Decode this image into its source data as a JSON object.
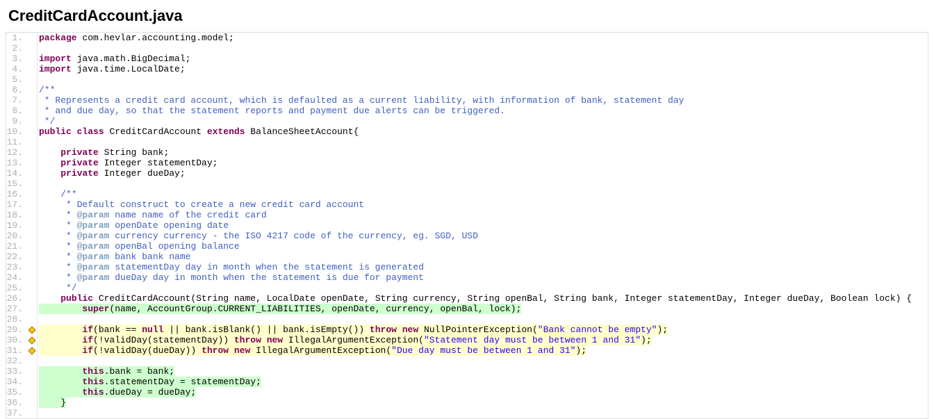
{
  "title": "CreditCardAccount.java",
  "lines": [
    {
      "n": 1,
      "glyph": false,
      "segs": [
        {
          "t": "package",
          "c": "kw"
        },
        {
          "t": " com.hevlar.accounting.model;"
        }
      ]
    },
    {
      "n": 2,
      "glyph": false,
      "segs": []
    },
    {
      "n": 3,
      "glyph": false,
      "segs": [
        {
          "t": "import",
          "c": "kw"
        },
        {
          "t": " java.math.BigDecimal;"
        }
      ]
    },
    {
      "n": 4,
      "glyph": false,
      "segs": [
        {
          "t": "import",
          "c": "kw"
        },
        {
          "t": " java.time.LocalDate;"
        }
      ]
    },
    {
      "n": 5,
      "glyph": false,
      "segs": []
    },
    {
      "n": 6,
      "glyph": false,
      "segs": [
        {
          "t": "/**",
          "c": "cmt"
        }
      ]
    },
    {
      "n": 7,
      "glyph": false,
      "segs": [
        {
          "t": " * Represents a credit card account, which is defaulted as a current liability, with information of bank, statement day",
          "c": "cmt"
        }
      ]
    },
    {
      "n": 8,
      "glyph": false,
      "segs": [
        {
          "t": " * and due day, so that the statement reports and payment due alerts can be triggered.",
          "c": "cmt"
        }
      ]
    },
    {
      "n": 9,
      "glyph": false,
      "segs": [
        {
          "t": " */",
          "c": "cmt"
        }
      ]
    },
    {
      "n": 10,
      "glyph": false,
      "segs": [
        {
          "t": "public",
          "c": "kw"
        },
        {
          "t": " "
        },
        {
          "t": "class",
          "c": "kw"
        },
        {
          "t": " CreditCardAccount "
        },
        {
          "t": "extends",
          "c": "kw"
        },
        {
          "t": " BalanceSheetAccount{"
        }
      ]
    },
    {
      "n": 11,
      "glyph": false,
      "segs": []
    },
    {
      "n": 12,
      "glyph": false,
      "segs": [
        {
          "t": "    "
        },
        {
          "t": "private",
          "c": "kw"
        },
        {
          "t": " String bank;"
        }
      ]
    },
    {
      "n": 13,
      "glyph": false,
      "segs": [
        {
          "t": "    "
        },
        {
          "t": "private",
          "c": "kw"
        },
        {
          "t": " Integer statementDay;"
        }
      ]
    },
    {
      "n": 14,
      "glyph": false,
      "segs": [
        {
          "t": "    "
        },
        {
          "t": "private",
          "c": "kw"
        },
        {
          "t": " Integer dueDay;"
        }
      ]
    },
    {
      "n": 15,
      "glyph": false,
      "segs": []
    },
    {
      "n": 16,
      "glyph": false,
      "segs": [
        {
          "t": "    "
        },
        {
          "t": "/**",
          "c": "cmt"
        }
      ]
    },
    {
      "n": 17,
      "glyph": false,
      "segs": [
        {
          "t": "     * Default construct to create a new credit card account",
          "c": "cmt"
        }
      ]
    },
    {
      "n": 18,
      "glyph": false,
      "segs": [
        {
          "t": "     * ",
          "c": "cmt"
        },
        {
          "t": "@param",
          "c": "ann"
        },
        {
          "t": " name name of the credit card",
          "c": "cmt"
        }
      ]
    },
    {
      "n": 19,
      "glyph": false,
      "segs": [
        {
          "t": "     * ",
          "c": "cmt"
        },
        {
          "t": "@param",
          "c": "ann"
        },
        {
          "t": " openDate opening date",
          "c": "cmt"
        }
      ]
    },
    {
      "n": 20,
      "glyph": false,
      "segs": [
        {
          "t": "     * ",
          "c": "cmt"
        },
        {
          "t": "@param",
          "c": "ann"
        },
        {
          "t": " currency currency - the ISO 4217 code of the currency, eg. SGD, USD",
          "c": "cmt"
        }
      ]
    },
    {
      "n": 21,
      "glyph": false,
      "segs": [
        {
          "t": "     * ",
          "c": "cmt"
        },
        {
          "t": "@param",
          "c": "ann"
        },
        {
          "t": " openBal opening balance",
          "c": "cmt"
        }
      ]
    },
    {
      "n": 22,
      "glyph": false,
      "segs": [
        {
          "t": "     * ",
          "c": "cmt"
        },
        {
          "t": "@param",
          "c": "ann"
        },
        {
          "t": " bank bank name",
          "c": "cmt"
        }
      ]
    },
    {
      "n": 23,
      "glyph": false,
      "segs": [
        {
          "t": "     * ",
          "c": "cmt"
        },
        {
          "t": "@param",
          "c": "ann"
        },
        {
          "t": " statementDay day in month when the statement is generated",
          "c": "cmt"
        }
      ]
    },
    {
      "n": 24,
      "glyph": false,
      "segs": [
        {
          "t": "     * ",
          "c": "cmt"
        },
        {
          "t": "@param",
          "c": "ann"
        },
        {
          "t": " dueDay day in month when the statement is due for payment",
          "c": "cmt"
        }
      ]
    },
    {
      "n": 25,
      "glyph": false,
      "segs": [
        {
          "t": "     */",
          "c": "cmt"
        }
      ]
    },
    {
      "n": 26,
      "glyph": false,
      "segs": [
        {
          "t": "    "
        },
        {
          "t": "public",
          "c": "kw"
        },
        {
          "t": " CreditCardAccount(String name, LocalDate openDate, String currency, String openBal, String bank, Integer statementDay, Integer dueDay, Boolean lock) {"
        }
      ]
    },
    {
      "n": 27,
      "glyph": false,
      "hl": "green",
      "segs": [
        {
          "t": "        "
        },
        {
          "t": "super",
          "c": "kw"
        },
        {
          "t": "(name, AccountGroup.CURRENT_LIABILITIES, openDate, currency, openBal, lock);"
        }
      ]
    },
    {
      "n": 28,
      "glyph": false,
      "segs": []
    },
    {
      "n": 29,
      "glyph": true,
      "hl": "yellow",
      "segs": [
        {
          "t": "        "
        },
        {
          "t": "if",
          "c": "kw"
        },
        {
          "t": "(bank == "
        },
        {
          "t": "null",
          "c": "kw"
        },
        {
          "t": " || bank.isBlank() || bank.isEmpty()) "
        },
        {
          "t": "throw",
          "c": "kw"
        },
        {
          "t": " "
        },
        {
          "t": "new",
          "c": "kw"
        },
        {
          "t": " NullPointerException("
        },
        {
          "t": "\"Bank cannot be empty\"",
          "c": "str"
        },
        {
          "t": ");"
        }
      ]
    },
    {
      "n": 30,
      "glyph": true,
      "hl": "yellow",
      "segs": [
        {
          "t": "        "
        },
        {
          "t": "if",
          "c": "kw"
        },
        {
          "t": "(!validDay(statementDay)) "
        },
        {
          "t": "throw",
          "c": "kw"
        },
        {
          "t": " "
        },
        {
          "t": "new",
          "c": "kw"
        },
        {
          "t": " IllegalArgumentException("
        },
        {
          "t": "\"Statement day must be between 1 and 31\"",
          "c": "str"
        },
        {
          "t": ");"
        }
      ]
    },
    {
      "n": 31,
      "glyph": true,
      "hl": "yellow",
      "segs": [
        {
          "t": "        "
        },
        {
          "t": "if",
          "c": "kw"
        },
        {
          "t": "(!validDay(dueDay)) "
        },
        {
          "t": "throw",
          "c": "kw"
        },
        {
          "t": " "
        },
        {
          "t": "new",
          "c": "kw"
        },
        {
          "t": " IllegalArgumentException("
        },
        {
          "t": "\"Due day must be between 1 and 31\"",
          "c": "str"
        },
        {
          "t": ");"
        }
      ]
    },
    {
      "n": 32,
      "glyph": false,
      "segs": []
    },
    {
      "n": 33,
      "glyph": false,
      "hl": "green",
      "segs": [
        {
          "t": "        "
        },
        {
          "t": "this",
          "c": "kw"
        },
        {
          "t": ".bank = bank;"
        }
      ]
    },
    {
      "n": 34,
      "glyph": false,
      "hl": "green",
      "segs": [
        {
          "t": "        "
        },
        {
          "t": "this",
          "c": "kw"
        },
        {
          "t": ".statementDay = statementDay;"
        }
      ]
    },
    {
      "n": 35,
      "glyph": false,
      "hl": "green",
      "segs": [
        {
          "t": "        "
        },
        {
          "t": "this",
          "c": "kw"
        },
        {
          "t": ".dueDay = dueDay;"
        }
      ]
    },
    {
      "n": 36,
      "glyph": false,
      "hl": "green",
      "segs": [
        {
          "t": "    }"
        }
      ]
    },
    {
      "n": 37,
      "glyph": false,
      "segs": []
    }
  ]
}
